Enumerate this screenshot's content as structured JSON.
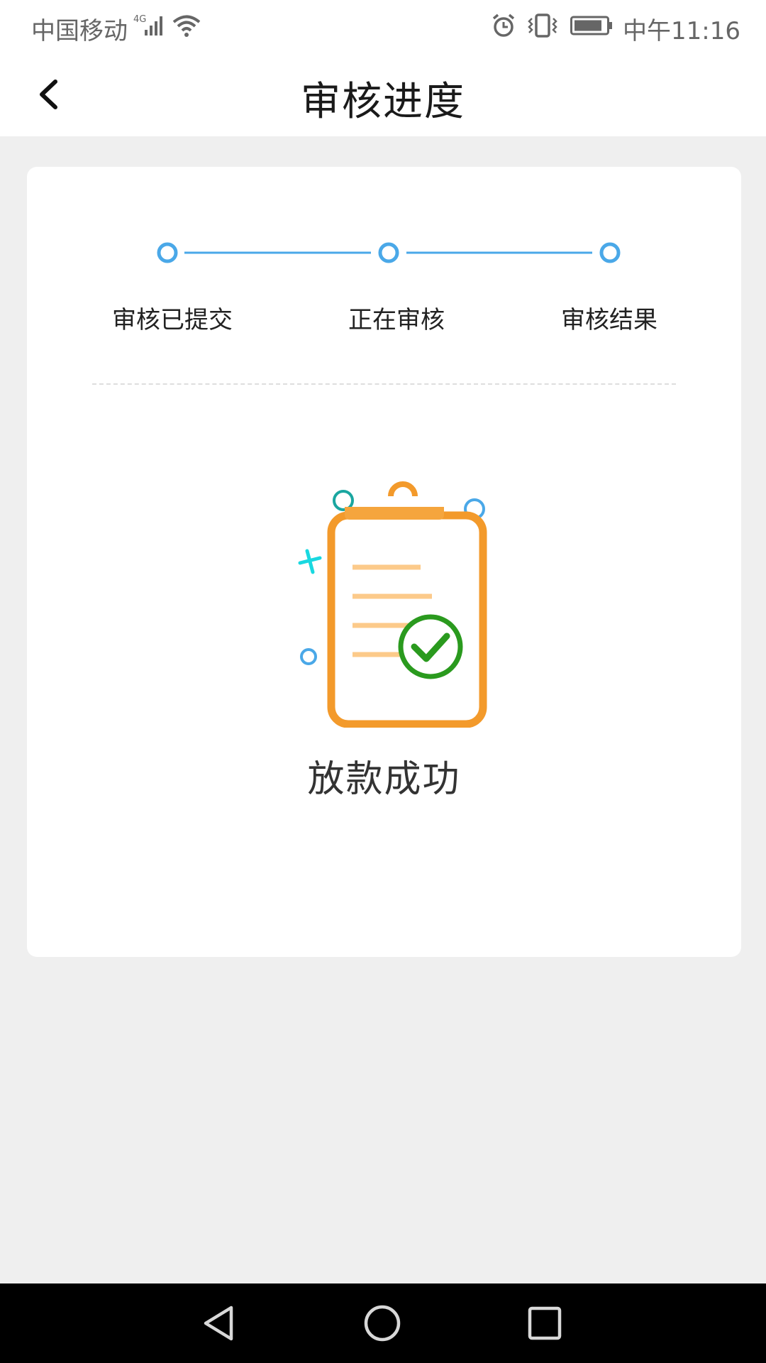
{
  "status_bar": {
    "carrier": "中国移动",
    "network": "4G",
    "time": "中午11:16",
    "icons": [
      "signal-icon",
      "wifi-icon",
      "alarm-icon",
      "vibrate-icon",
      "battery-icon"
    ]
  },
  "header": {
    "title": "审核进度",
    "back_icon": "chevron-left-icon"
  },
  "progress": {
    "steps": [
      {
        "label": "审核已提交"
      },
      {
        "label": "正在审核"
      },
      {
        "label": "审核结果"
      }
    ],
    "accent_color": "#4aa8e8"
  },
  "result": {
    "text": "放款成功",
    "icon": "clipboard-check-icon",
    "colors": {
      "clipboard": "#f39a2b",
      "check": "#2a9a1e"
    }
  },
  "nav_bar": {
    "icons": [
      "back-triangle-icon",
      "home-circle-icon",
      "recents-square-icon"
    ]
  }
}
